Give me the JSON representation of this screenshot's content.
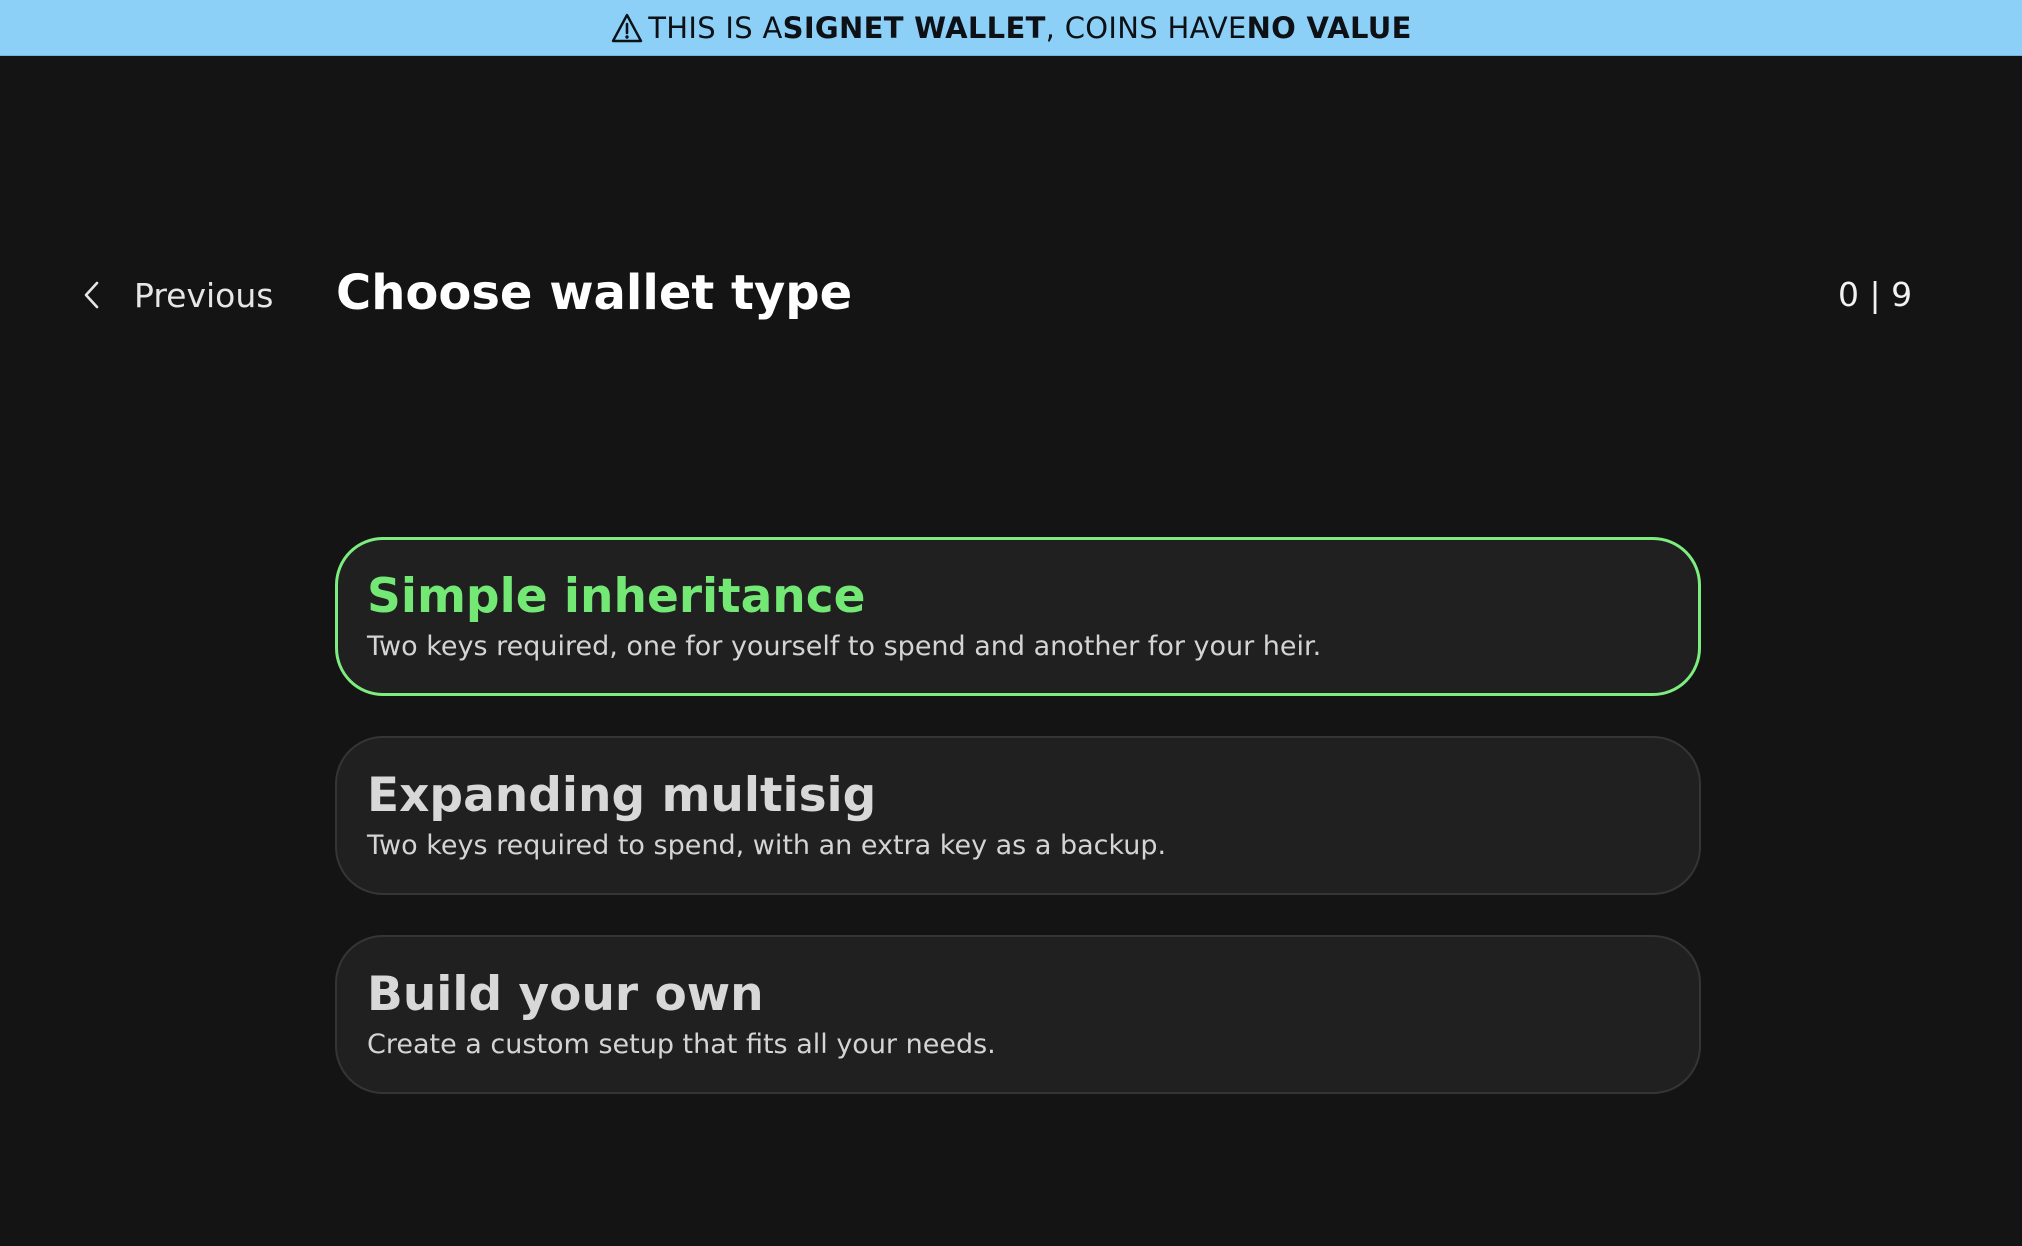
{
  "banner": {
    "icon": "warning-icon",
    "part1": "THIS IS A ",
    "bold1": "SIGNET WALLET",
    "part2": ", COINS HAVE ",
    "bold2": "NO VALUE",
    "background": "#8dd0f7"
  },
  "header": {
    "previous_icon": "chevron-left-icon",
    "previous_label": "Previous",
    "title": "Choose wallet type",
    "step_counter": "0 | 9"
  },
  "options": [
    {
      "title": "Simple inheritance",
      "description": "Two keys required, one for yourself to spend and another for your heir.",
      "selected": true
    },
    {
      "title": "Expanding multisig",
      "description": "Two keys required to spend, with an extra key as a backup.",
      "selected": false
    },
    {
      "title": "Build your own",
      "description": "Create a custom setup that fits all your needs.",
      "selected": false
    }
  ],
  "colors": {
    "background": "#141414",
    "card": "#202020",
    "accent_green": "#74e874"
  }
}
